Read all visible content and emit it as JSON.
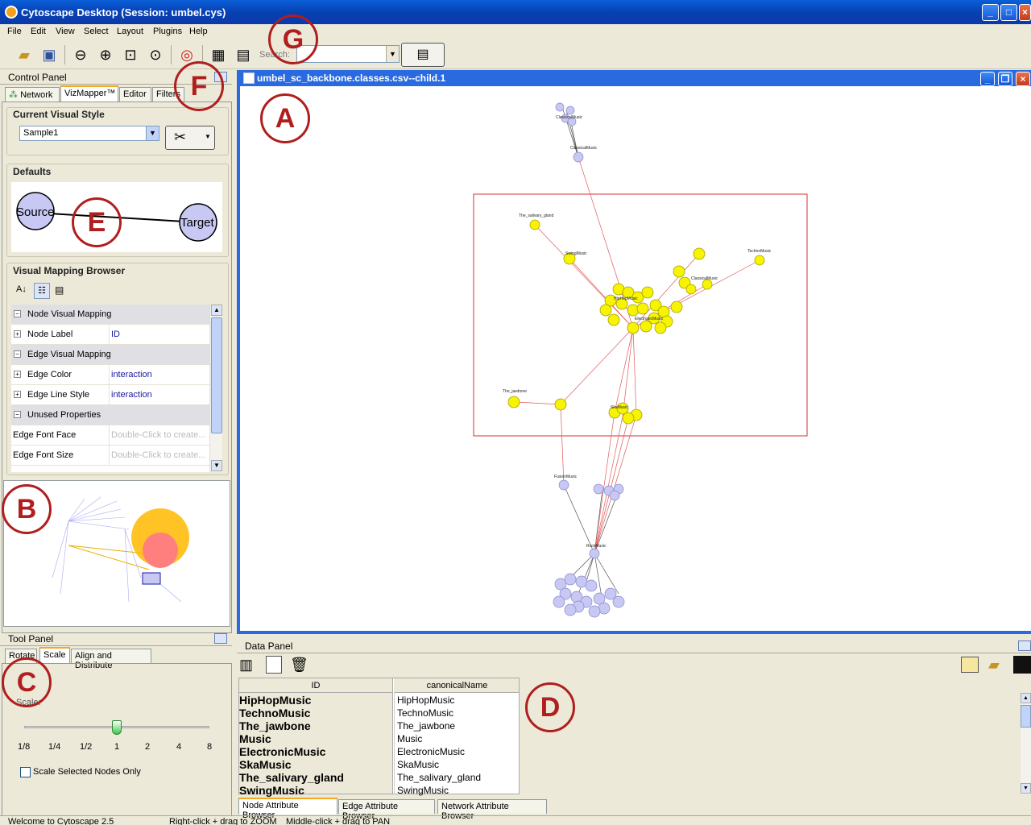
{
  "window": {
    "title": "Cytoscape Desktop (Session: umbel.cys)"
  },
  "menu": [
    "File",
    "Edit",
    "View",
    "Select",
    "Layout",
    "Plugins",
    "Help"
  ],
  "toolbar": {
    "search_label": "Search:"
  },
  "control_panel": {
    "title": "Control Panel",
    "tabs": [
      "Network",
      "VizMapper™",
      "Editor",
      "Filters"
    ],
    "current_style_title": "Current Visual Style",
    "current_style_value": "Sample1",
    "defaults_title": "Defaults",
    "default_source": "Source",
    "default_target": "Target",
    "mapping_title": "Visual Mapping Browser",
    "mapping_rows": [
      {
        "label": "Node Visual Mapping",
        "value": "",
        "type": "header"
      },
      {
        "label": "Node Label",
        "value": "ID",
        "type": "item"
      },
      {
        "label": "Edge Visual Mapping",
        "value": "",
        "type": "header"
      },
      {
        "label": "Edge Color",
        "value": "interaction",
        "type": "item"
      },
      {
        "label": "Edge Line Style",
        "value": "interaction",
        "type": "item"
      },
      {
        "label": "Unused Properties",
        "value": "",
        "type": "header"
      },
      {
        "label": "Edge Font Face",
        "value": "Double-Click to create...",
        "type": "unused"
      },
      {
        "label": "Edge Font Size",
        "value": "Double-Click to create...",
        "type": "unused"
      }
    ]
  },
  "tool_panel": {
    "title": "Tool Panel",
    "tabs": [
      "Rotate",
      "Scale",
      "Align and Distribute"
    ],
    "scale_label": "Scale:",
    "ticks": [
      "1/8",
      "1/4",
      "1/2",
      "1",
      "2",
      "4",
      "8"
    ],
    "slider_value_fraction": 0.5,
    "checkbox_label": "Scale Selected Nodes Only"
  },
  "network": {
    "title": "umbel_sc_backbone.classes.csv--child.1",
    "node_labels": [
      "ClassicalMusic",
      "HipHopMusic",
      "TechnoMusic",
      "The_jawbone",
      "The_salivary_gland",
      "FusionMusic",
      "RockMusic",
      "SkaMusic",
      "SwingMusic",
      "ElectronicMusic",
      "Music"
    ]
  },
  "data_panel": {
    "title": "Data Panel",
    "columns": [
      "ID",
      "canonicalName"
    ],
    "rows": [
      [
        "HipHopMusic",
        "HipHopMusic"
      ],
      [
        "TechnoMusic",
        "TechnoMusic"
      ],
      [
        "The_jawbone",
        "The_jawbone"
      ],
      [
        "Music",
        "Music"
      ],
      [
        "ElectronicMusic",
        "ElectronicMusic"
      ],
      [
        "SkaMusic",
        "SkaMusic"
      ],
      [
        "The_salivary_gland",
        "The_salivary_gland"
      ],
      [
        "SwingMusic",
        "SwingMusic"
      ]
    ],
    "tabs": [
      "Node Attribute Browser",
      "Edge Attribute Browser",
      "Network Attribute Browser"
    ]
  },
  "statusbar": {
    "left": "Welcome to Cytoscape 2.5",
    "mid": "Right-click + drag  to  ZOOM",
    "right": "Middle-click + drag  to  PAN"
  },
  "annotations": [
    "A",
    "B",
    "C",
    "D",
    "E",
    "F",
    "G"
  ]
}
